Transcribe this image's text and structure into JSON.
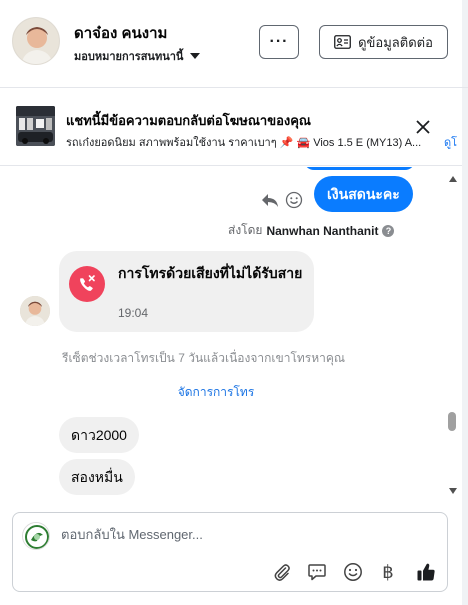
{
  "header": {
    "name": "ดาจ๋อง คนงาม",
    "subtitle": "มอบหมายการสนทนานี้",
    "more_label": "···",
    "contact_label": "ดูข้อมูลติดต่อ"
  },
  "ad_banner": {
    "title": "แชทนี้มีข้อความตอบกลับต่อโฆษณาของคุณ",
    "description": "รถเก๋งยอดนิยม สภาพพร้อมใช้งาน ราคาเบาๆ 📌 🚘 Vios 1.5 E (MY13) A...",
    "link_label": "ดูโ"
  },
  "chat": {
    "outgoing_message": "เงินสดนะคะ",
    "sent_by_prefix": "ส่งโดย",
    "sent_by_name": "Nanwhan Nanthanit",
    "missed_call": {
      "title": "การโทรด้วยเสียงที่ไม่ได้รับสาย",
      "time": "19:04"
    },
    "system_note": "รีเซ็ตช่วงเวลาโทรเป็น 7 วันแล้วเนื่องจากเขาโทรหาคุณ",
    "manage_calls_label": "จัดการการโทร",
    "incoming_messages": [
      "ดาว2000",
      "สองหมื่น"
    ]
  },
  "composer": {
    "placeholder": "ตอบกลับใน Messenger...",
    "baht_symbol": "฿"
  },
  "icons": {
    "attachment": "paperclip-icon",
    "saved_replies": "chat-bubble-icon",
    "emoji": "smiley-icon",
    "payment": "baht-icon",
    "like": "thumbs-up-icon"
  },
  "colors": {
    "accent_blue": "#0a7cff",
    "link_blue": "#1b74e4",
    "missed_call_red": "#f0435c",
    "bubble_gray": "#f0f0f0"
  }
}
